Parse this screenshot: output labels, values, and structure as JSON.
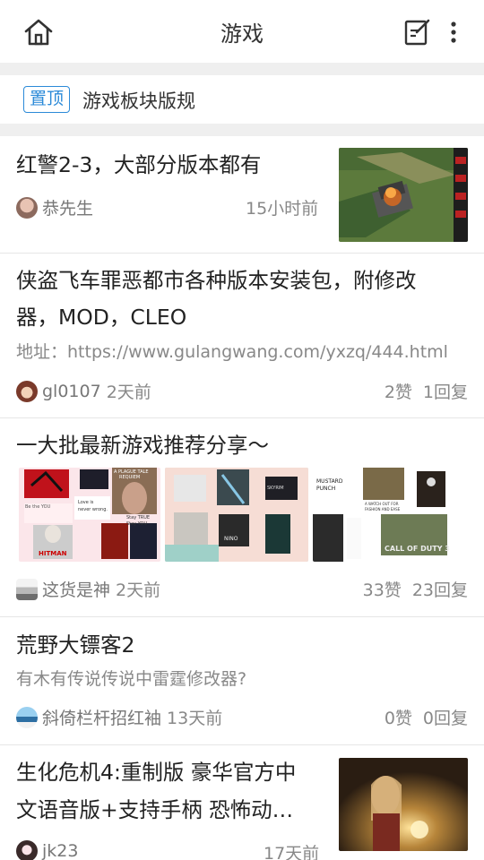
{
  "header": {
    "title": "游戏",
    "home_icon": "home-icon",
    "edit_icon": "edit-icon",
    "more_icon": "more-vertical-icon"
  },
  "pinned": {
    "badge": "置顶",
    "text": "游戏板块版规"
  },
  "posts": [
    {
      "title": "红警2-3，大部分版本都有",
      "author": "恭先生",
      "time": "15小时前",
      "has_thumbnail": true
    },
    {
      "title_line1": "侠盗飞车罪恶都市各种版本安装包，附修改",
      "title_line2": "器，MOD，CLEO",
      "excerpt": "地址：https://www.gulangwang.com/yxzq/444.html",
      "author": "gl0107",
      "time": "2天前",
      "likes": "2赞",
      "replies": "1回复"
    },
    {
      "title": "一大批最新游戏推荐分享～",
      "author": "这货是神",
      "time": "2天前",
      "likes": "33赞",
      "replies": "23回复",
      "image_captions": {
        "img1": [
          "Be the YOU",
          "Love is",
          "never wrong.",
          "Stay TRUE",
          "Stay YOU",
          "HITMAN",
          "A PLAGUE TALE",
          "REQUIEM"
        ],
        "img2": [
          "SKYRIM",
          "NINO"
        ],
        "img3": [
          "MUSTARD",
          "PUNCH",
          "A WATCH OUT FOR",
          "FASHION AND EASE",
          "CALL OF DUTY 3"
        ]
      }
    },
    {
      "title": "荒野大镖客2",
      "excerpt": "有木有传说传说中雷霆修改器?",
      "author": "斜倚栏杆招红袖",
      "time": "13天前",
      "likes": "0赞",
      "replies": "0回复"
    },
    {
      "title_line1": "生化危机4:重制版 豪华官方中",
      "title_line2": "文语音版+支持手柄 恐怖动…",
      "author": "jk23",
      "time": "17天前",
      "has_thumbnail": true
    }
  ],
  "colors": {
    "accent": "#2b8ad8",
    "divider": "#efefef",
    "meta_text": "#888888"
  }
}
